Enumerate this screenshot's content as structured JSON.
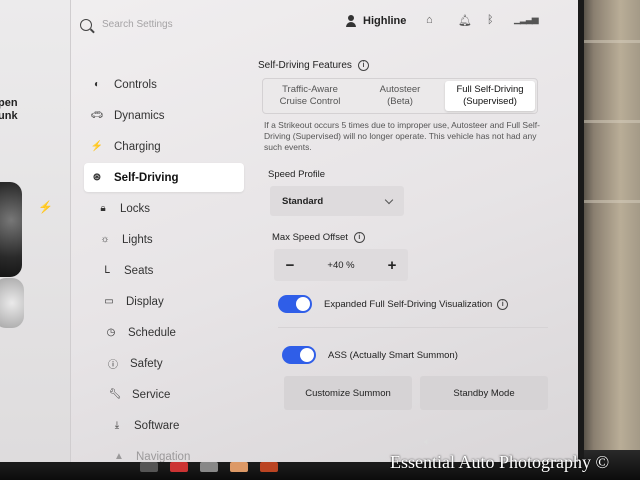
{
  "top_bar": {
    "search_placeholder": "Search Settings",
    "profile_name": "Highline",
    "status_icons": [
      "home-icon",
      "bell-icon",
      "bluetooth-icon",
      "lte-signal-icon"
    ]
  },
  "car_panel": {
    "text_line1": "pen",
    "text_line2": "unk",
    "icon": "bolt-icon"
  },
  "sidebar": {
    "items": [
      {
        "label": "Controls",
        "icon": "toggle-icon"
      },
      {
        "label": "Dynamics",
        "icon": "car-icon"
      },
      {
        "label": "Charging",
        "icon": "bolt-icon"
      },
      {
        "label": "Self-Driving",
        "icon": "steering-wheel-icon",
        "active": true
      },
      {
        "label": "Locks",
        "icon": "lock-icon"
      },
      {
        "label": "Lights",
        "icon": "sun-icon"
      },
      {
        "label": "Seats",
        "icon": "seat-icon"
      },
      {
        "label": "Display",
        "icon": "display-icon"
      },
      {
        "label": "Schedule",
        "icon": "clock-icon"
      },
      {
        "label": "Safety",
        "icon": "info-circle-icon"
      },
      {
        "label": "Service",
        "icon": "wrench-icon"
      },
      {
        "label": "Software",
        "icon": "download-icon"
      },
      {
        "label": "Navigation",
        "icon": "nav-arrow-icon"
      }
    ]
  },
  "main": {
    "features_title": "Self-Driving Features",
    "feature_options": [
      {
        "line1": "Traffic-Aware",
        "line2": "Cruise Control",
        "selected": false
      },
      {
        "line1": "Autosteer",
        "line2": "(Beta)",
        "selected": false
      },
      {
        "line1": "Full Self-Driving",
        "line2": "(Supervised)",
        "selected": true
      }
    ],
    "warning_text": "If a Strikeout occurs 5 times due to improper use, Autosteer and Full Self-Driving (Supervised) will no longer operate. This vehicle has not had any such events.",
    "speed_profile_label": "Speed Profile",
    "speed_profile_value": "Standard",
    "max_speed_offset_label": "Max Speed Offset",
    "max_speed_offset_value": "+40 %",
    "minus_label": "−",
    "plus_label": "+",
    "toggle1_label": "Expanded Full Self-Driving Visualization",
    "toggle1_on": true,
    "toggle2_label": "ASS (Actually Smart Summon)",
    "toggle2_on": true,
    "customize_summon_label": "Customize Summon",
    "standby_mode_label": "Standby Mode"
  },
  "watermark": "Essential Auto Photography ©",
  "colors": {
    "accent": "#2f5ee8",
    "screen_bg": "#efedee",
    "active_item_bg": "#ffffff"
  }
}
